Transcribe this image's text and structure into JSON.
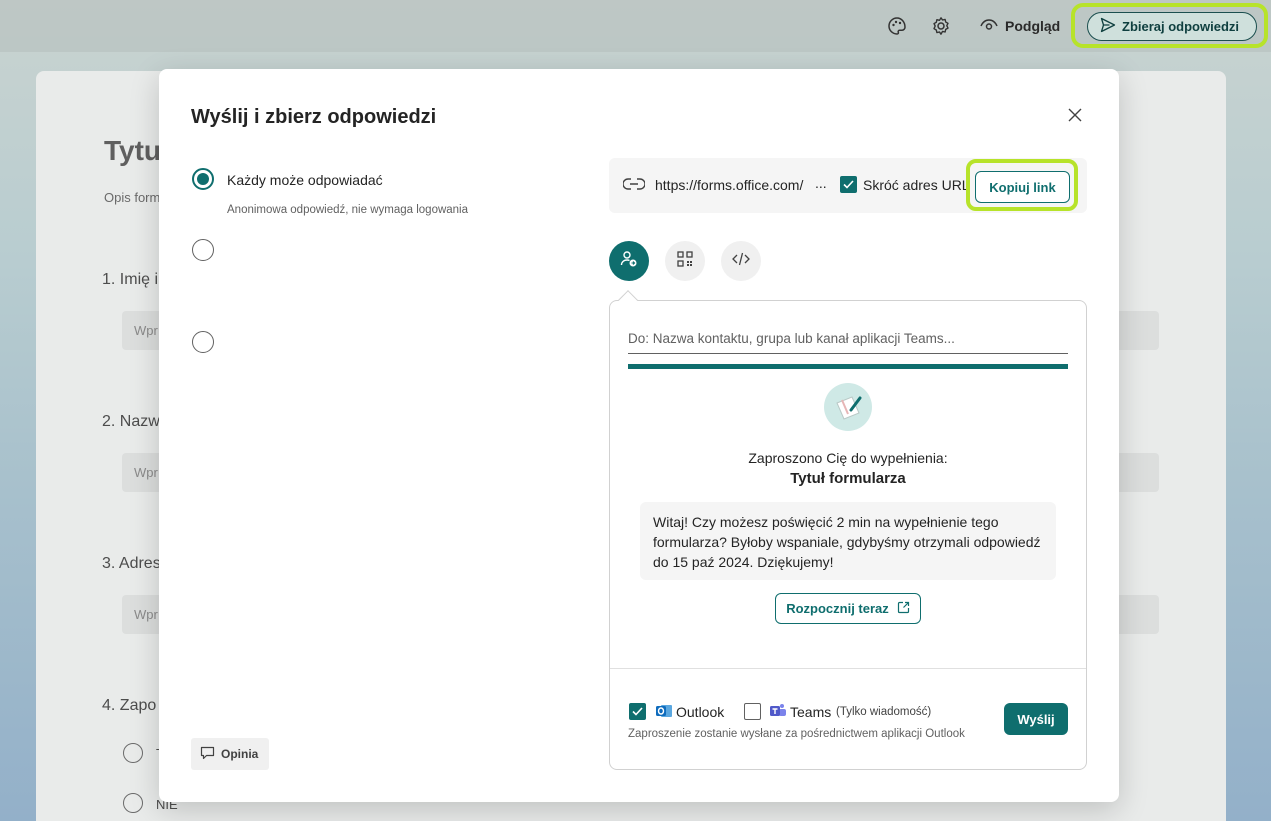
{
  "background": {
    "form_title": "Tytu",
    "form_desc": "Opis form",
    "questions": [
      {
        "label": "1. Imię i",
        "placeholder": "Wpr"
      },
      {
        "label": "2. Nazw",
        "placeholder": "Wpr"
      },
      {
        "label": "3. Adres",
        "placeholder": "Wpr"
      },
      {
        "label": "4. Zapo",
        "placeholder": ""
      }
    ],
    "q4_options": [
      "T",
      "NIE"
    ]
  },
  "topbar": {
    "preview_label": "Podgląd",
    "collect_label": "Zbieraj odpowiedzi"
  },
  "modal": {
    "title": "Wyślij i zbierz odpowiedzi",
    "options": [
      {
        "label": "Każdy może odpowiadać",
        "sub": "Anonimowa odpowiedź, nie wymaga logowania",
        "checked": true
      },
      {
        "label": "",
        "sub": "",
        "checked": false
      },
      {
        "label": "",
        "sub": "",
        "checked": false
      }
    ],
    "feedback_label": "Opinia",
    "link": {
      "url": "https://forms.office.com/",
      "ellipsis": "...",
      "shorten_label": "Skróć adres URL",
      "shorten_checked": true,
      "copy_label": "Kopiuj link"
    },
    "share_tabs": [
      {
        "icon": "person-link-icon",
        "active": true
      },
      {
        "icon": "qr-code-icon",
        "active": false
      },
      {
        "icon": "embed-code-icon",
        "active": false
      }
    ],
    "email_panel": {
      "to_placeholder": "Do: Nazwa kontaktu, grupa lub kanał aplikacji Teams...",
      "invite_text": "Zaproszono Cię do wypełnienia:",
      "invite_title": "Tytuł formularza",
      "message": "Witaj! Czy możesz poświęcić 2 min na wypełnienie tego formularza? Byłoby wspaniale, gdybyśmy otrzymali odpowiedź do 15 paź 2024. Dziękujemy!",
      "start_label": "Rozpocznij teraz",
      "outlook_label": "Outlook",
      "outlook_checked": true,
      "teams_label": "Teams",
      "teams_note": "(Tylko wiadomość)",
      "teams_checked": false,
      "send_note": "Zaproszenie zostanie wysłane za pośrednictwem aplikacji Outlook",
      "send_label": "Wyślij"
    }
  },
  "colors": {
    "accent": "#0f6e6e",
    "highlight": "#b7e32a"
  }
}
